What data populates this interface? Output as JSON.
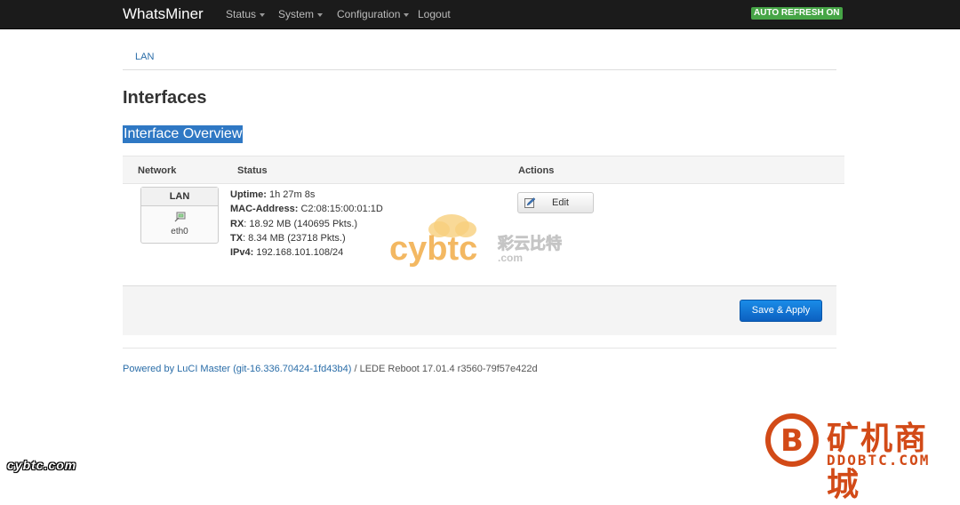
{
  "navbar": {
    "brand": "WhatsMiner",
    "menu": [
      {
        "label": "Status"
      },
      {
        "label": "System"
      },
      {
        "label": "Configuration"
      },
      {
        "label": "Logout"
      }
    ],
    "auto_refresh": "AUTO REFRESH ON"
  },
  "tabs": [
    {
      "label": "LAN"
    }
  ],
  "page": {
    "title": "Interfaces",
    "section_title": "Interface Overview"
  },
  "table": {
    "headers": {
      "network": "Network",
      "status": "Status",
      "actions": "Actions"
    },
    "rows": [
      {
        "network_name": "LAN",
        "device": "eth0",
        "status": {
          "uptime_label": "Uptime:",
          "uptime": "1h 27m 8s",
          "mac_label": "MAC-Address:",
          "mac": "C2:08:15:00:01:1D",
          "rx_label": "RX",
          "rx": ": 18.92 MB (140695 Pkts.)",
          "tx_label": "TX",
          "tx": ": 8.34 MB (23718 Pkts.)",
          "ipv4_label": "IPv4:",
          "ipv4": "192.168.101.108/24"
        },
        "edit_label": "Edit"
      }
    ]
  },
  "actions": {
    "save_apply": "Save & Apply"
  },
  "footer": {
    "powered_link": "Powered by LuCI Master (git-16.336.70424-1fd43b4)",
    "version": " / LEDE Reboot 17.01.4 r3560-79f57e422d"
  },
  "watermarks": {
    "center_text": "cybtc",
    "center_suffix": ".com",
    "center_cn": "彩云比特",
    "bottom_left": "cybtc.com",
    "corner_cn": "矿机商城",
    "corner_en": "DDOBTC.COM"
  },
  "colors": {
    "navbar_bg": "#1b1b1b",
    "accent_link": "#2a6da8",
    "auto_refresh_bg": "#46a546",
    "primary_button": "#1479d6",
    "selection_highlight": "#2f78c4",
    "watermark_orange": "#d24a17"
  }
}
